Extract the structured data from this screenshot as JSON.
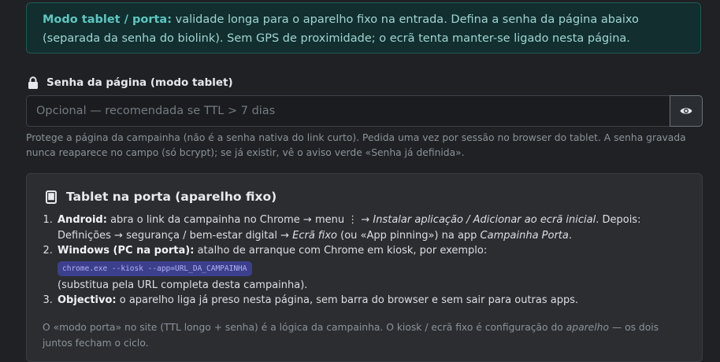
{
  "banner": {
    "title": "Modo tablet / porta:",
    "text": " validade longa para o aparelho fixo na entrada. Defina a senha da página abaixo (separada da senha do biolink). Sem GPS de proximidade; o ecrã tenta manter-se ligado nesta página."
  },
  "password_field": {
    "label": "Senha da página (modo tablet)",
    "placeholder": "Opcional — recomendada se TTL > 7 dias",
    "value": "",
    "help": "Protege a página da campainha (não é a senha nativa do link curto). Pedida uma vez por sessão no browser do tablet. A senha gravada nunca reaparece no campo (só bcrypt); se já existir, vê o aviso verde «Senha já definida»."
  },
  "panel": {
    "title": "Tablet na porta (aparelho fixo)",
    "steps": [
      {
        "label": "Android:",
        "t1": " abra o link da campainha no Chrome → menu ⋮ → ",
        "i1": "Instalar aplicação / Adicionar ao ecrã inicial",
        "t2": ". Depois: Definições → segurança / bem-estar digital → ",
        "i2": "Ecrã fixo",
        "t3": " (ou «App pinning») na app ",
        "i3": "Campainha Porta",
        "t4": "."
      },
      {
        "label": "Windows (PC na porta):",
        "t1": " atalho de arranque com Chrome em kiosk, por exemplo:",
        "code": "chrome.exe --kiosk --app=URL_DA_CAMPAINHA",
        "t2": "(substitua pela URL completa desta campainha)."
      },
      {
        "label": "Objectivo:",
        "t1": " o aparelho liga já preso nesta página, sem barra do browser e sem sair para outras apps."
      }
    ],
    "note": {
      "t1": "O «modo porta» no site (TTL longo + senha) é a lógica da campainha. O kiosk / ecrã fixo é configuração do ",
      "i1": "aparelho",
      "t2": " — os dois juntos fecham o ciclo."
    }
  },
  "icons": {
    "lock": "lock-icon",
    "eye": "eye-icon",
    "tablet": "tablet-icon"
  }
}
